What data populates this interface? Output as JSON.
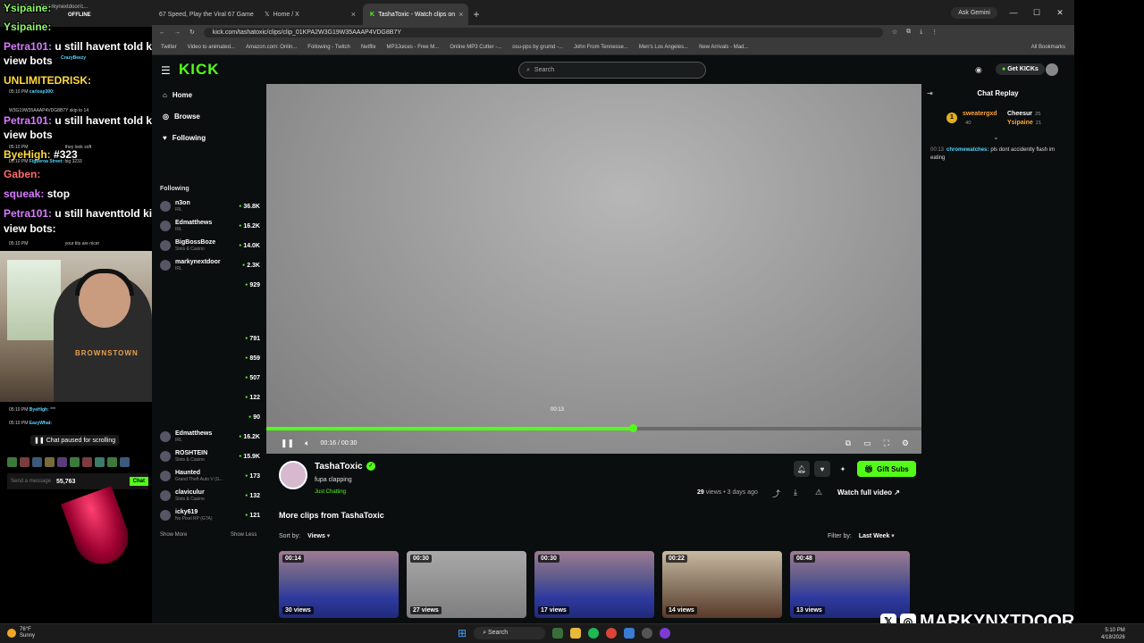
{
  "browser": {
    "tabs": [
      {
        "label": "67 Speed, Play the Viral 67 Game",
        "active": false
      },
      {
        "label": "Home / X",
        "active": false
      },
      {
        "label": "TashaToxic - Watch clips on",
        "active": true
      }
    ],
    "new_tab": "+",
    "ask_gemini": "Ask Gemini",
    "url": "kick.com/tashatoxic/clips/clip_01KPA2W3G19W35AAAP4VDG8B7Y",
    "bookmarks": [
      "Twitter",
      "Video to animated...",
      "Amazon.com: Onlin...",
      "Following - Twitch",
      "Netflix",
      "MP3Juices - Free M...",
      "Online MP3 Cutter -...",
      "osu-pps by grumd -...",
      "John From Tennesse...",
      "Men's Los Angeles...",
      "New Arrivals - Mad...",
      "All Bookmarks"
    ]
  },
  "kick": {
    "logo": "KICK",
    "search_placeholder": "Search",
    "get_kicks": "Get KICKs",
    "nav": [
      {
        "label": "Home",
        "icon": "home-icon"
      },
      {
        "label": "Browse",
        "icon": "compass-icon"
      },
      {
        "label": "Following",
        "icon": "heart-icon"
      }
    ],
    "following_title": "Following",
    "following": [
      {
        "name": "n3on",
        "category": "IRL",
        "viewers": "36.8K"
      },
      {
        "name": "Edmatthews",
        "category": "IRL",
        "viewers": "16.2K"
      },
      {
        "name": "BigBossBoze",
        "category": "Slots & Casino",
        "viewers": "14.0K"
      },
      {
        "name": "markynextdoor",
        "category": "IRL",
        "viewers": "2.3K"
      },
      {
        "name": "",
        "category": "",
        "viewers": "929"
      },
      {
        "name": "",
        "category": "",
        "viewers": "791"
      },
      {
        "name": "",
        "category": "",
        "viewers": "859"
      },
      {
        "name": "",
        "category": "",
        "viewers": "507"
      },
      {
        "name": "",
        "category": "",
        "viewers": "122"
      },
      {
        "name": "",
        "category": "",
        "viewers": "90"
      },
      {
        "name": "Edmatthews",
        "category": "IRL",
        "viewers": "16.2K"
      },
      {
        "name": "ROSHTEIN",
        "category": "Slots & Casino",
        "viewers": "15.9K"
      },
      {
        "name": "Haunted",
        "category": "Grand Theft Auto V (G...",
        "viewers": "173"
      },
      {
        "name": "claviculur",
        "category": "Slots & Casino",
        "viewers": "132"
      },
      {
        "name": "icky619",
        "category": "No Pixel RP (GTA)",
        "viewers": "121"
      }
    ],
    "show_more": "Show More",
    "show_less": "Show Less",
    "player": {
      "hover_time": "00:13",
      "time": "00:16 / 00:30",
      "played_fraction": 0.44,
      "buffered_fraction": 0.56
    },
    "channel": {
      "name": "TashaToxic",
      "clip_title": "fupa clapping",
      "category": "Just Chatting",
      "views": "29",
      "views_label": "views",
      "age": "3 days ago",
      "gift_subs": "Gift Subs",
      "watch_full": "Watch full video"
    },
    "more_clips_title": "More clips from TashaToxic",
    "sort_label": "Sort by:",
    "sort_value": "Views",
    "filter_label": "Filter by:",
    "filter_value": "Last Week",
    "clips": [
      {
        "duration": "00:14",
        "views": "30 views",
        "style": "casino"
      },
      {
        "duration": "00:30",
        "views": "27 views",
        "style": "fog"
      },
      {
        "duration": "00:30",
        "views": "17 views",
        "style": "casino"
      },
      {
        "duration": "00:22",
        "views": "14 views",
        "style": "person"
      },
      {
        "duration": "00:48",
        "views": "13 views",
        "style": "casino"
      }
    ],
    "chat_replay": {
      "title": "Chat Replay",
      "leader_rank": "1",
      "leaders": [
        {
          "name": "sweatergxd",
          "count": "40"
        },
        {
          "name": "Cheesur",
          "count": "25"
        },
        {
          "name": "Ysipaine",
          "count": "21"
        }
      ],
      "messages": [
        {
          "time": "00:13",
          "user": "chromewatches:",
          "text": "pls dont accidently flash im eating"
        }
      ]
    }
  },
  "stream_overlay": {
    "mini_chrome": [
      "kick.com/popout/markynextdoor/c...",
      "OFFLINE"
    ],
    "big_lines": [
      {
        "user": "Ysipaine:",
        "text": "",
        "class": "u"
      },
      {
        "user": "Ysipaine:",
        "text": "",
        "class": "u"
      },
      {
        "user": "Petra101:",
        "text": "u still havent told kick to fix the",
        "class": "u2"
      },
      {
        "user": "",
        "text": "view bots",
        "class": "u"
      },
      {
        "user": "UNLIMITEDRISK:",
        "text": "",
        "class": "u4"
      },
      {
        "user": "Petra101:",
        "text": "u still havent told kick to fix the",
        "class": "u2"
      },
      {
        "user": "",
        "text": "view bots",
        "class": "u"
      },
      {
        "user": "ByeHigh:",
        "text": "#323",
        "class": "u4"
      },
      {
        "user": "Gaben:",
        "text": "",
        "class": "u3"
      },
      {
        "user": "squeak:",
        "text": "stop",
        "class": "u2"
      },
      {
        "user": "Petra101:",
        "text": "u still haventtold kick to fix the",
        "class": "u2"
      },
      {
        "user": "",
        "text": "view bots:",
        "class": "u"
      }
    ],
    "small_lines": [
      {
        "time": "05:10 PM",
        "user": "CrazyBeezy",
        "text": ""
      },
      {
        "time": "05:10 PM",
        "user": "carlosp300:",
        "text": ""
      },
      {
        "time": "",
        "user": "",
        "text": "W3G19W35AAAP4VDG8B7Y skip to 14"
      },
      {
        "time": "05:10 PM",
        "user": "",
        "text": "they look soft"
      },
      {
        "time": "05:10 PM",
        "user": "Figueroa Street:",
        "text": "big 3233"
      },
      {
        "time": "05:10 PM",
        "user": "",
        "text": "your tits are nicer"
      },
      {
        "time": "05:10 PM",
        "user": "ByeHigh:",
        "text": "***"
      },
      {
        "time": "05:10 PM",
        "user": "EazyWhat:",
        "text": ""
      }
    ],
    "webcam_shirt": "BROWNSTOWN",
    "chat_paused": "Chat paused for scrolling",
    "send_placeholder": "Send a message",
    "points": "55,763",
    "chat_button": "Chat"
  },
  "watermark": "MARKYNXTDOOR",
  "taskbar": {
    "temp": "76°F",
    "weather": "Sunny",
    "search": "Search",
    "time": "5:10 PM",
    "date": "4/18/2026"
  }
}
